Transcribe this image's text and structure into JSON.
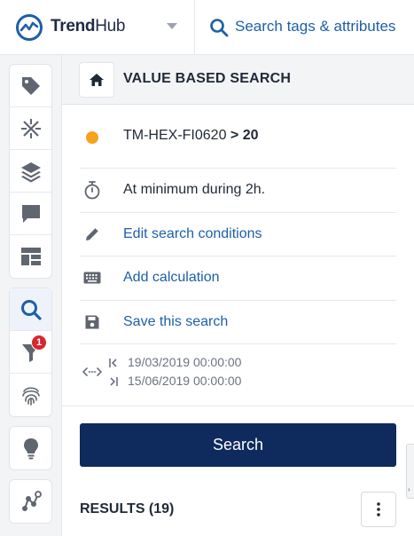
{
  "app": {
    "name_bold": "Trend",
    "name_light": "Hub"
  },
  "topbar": {
    "search_label": "Search tags & attributes"
  },
  "rail": {
    "filter_badge": "1"
  },
  "panel": {
    "title": "VALUE BASED SEARCH",
    "tag": "TM-HEX-FI0620",
    "operator": ">",
    "threshold": "20",
    "condition": "At minimum during 2h.",
    "edit_label": "Edit search conditions",
    "calc_label": "Add calculation",
    "save_label": "Save this search",
    "start_date": "19/03/2019 00:00:00",
    "end_date": "15/06/2019 00:00:00",
    "search_button": "Search",
    "results_title": "RESULTS (19)"
  },
  "colors": {
    "brand_navy": "#0f2a5c",
    "link_blue": "#1d5fa8",
    "status_orange": "#f5a21c",
    "badge_red": "#d7262e"
  }
}
